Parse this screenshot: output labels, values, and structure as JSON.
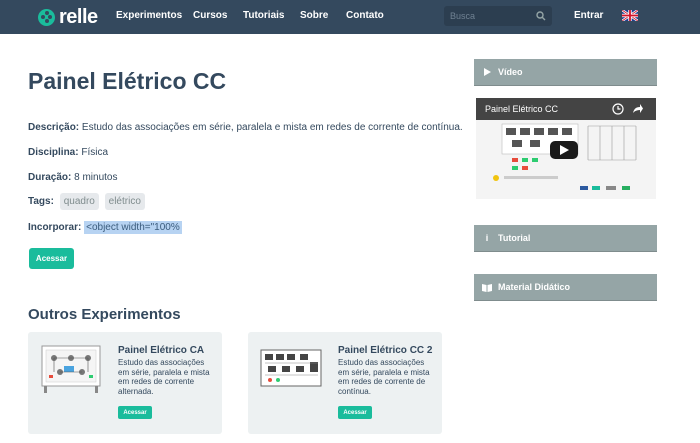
{
  "nav": {
    "logo": "relle",
    "links": [
      "Experimentos",
      "Cursos",
      "Tutoriais",
      "Sobre",
      "Contato"
    ],
    "search_placeholder": "Busca",
    "login": "Entrar",
    "language_icon": "uk-flag-icon"
  },
  "experiment": {
    "title": "Painel Elétrico CC",
    "description_label": "Descrição:",
    "description": "Estudo das associações em série, paralela e mista em redes de corrente de contínua.",
    "discipline_label": "Disciplina:",
    "discipline": "Física",
    "duration_label": "Duração:",
    "duration": "8 minutos",
    "tags_label": "Tags:",
    "tags": [
      "quadro",
      "elétrico"
    ],
    "embed_label": "Incorporar:",
    "embed_code": "<object width=\"100%",
    "access_button": "Acessar"
  },
  "others": {
    "title": "Outros Experimentos",
    "cards": [
      {
        "title": "Painel Elétrico CA",
        "description": "Estudo das associações em série, paralela e mista em redes de corrente alternada.",
        "button": "Acessar"
      },
      {
        "title": "Painel Elétrico CC 2",
        "description": "Estudo das associações em série, paralela e mista em redes de corrente de contínua.",
        "button": "Acessar"
      }
    ]
  },
  "sidebar": {
    "video_label": "Vídeo",
    "video_title": "Painel Elétrico CC",
    "tutorial_label": "Tutorial",
    "material_label": "Material Didático"
  },
  "colors": {
    "navbar": "#34495e",
    "accent": "#1abc9c",
    "panel": "#95a5a6",
    "card_bg": "#edf1f2"
  }
}
